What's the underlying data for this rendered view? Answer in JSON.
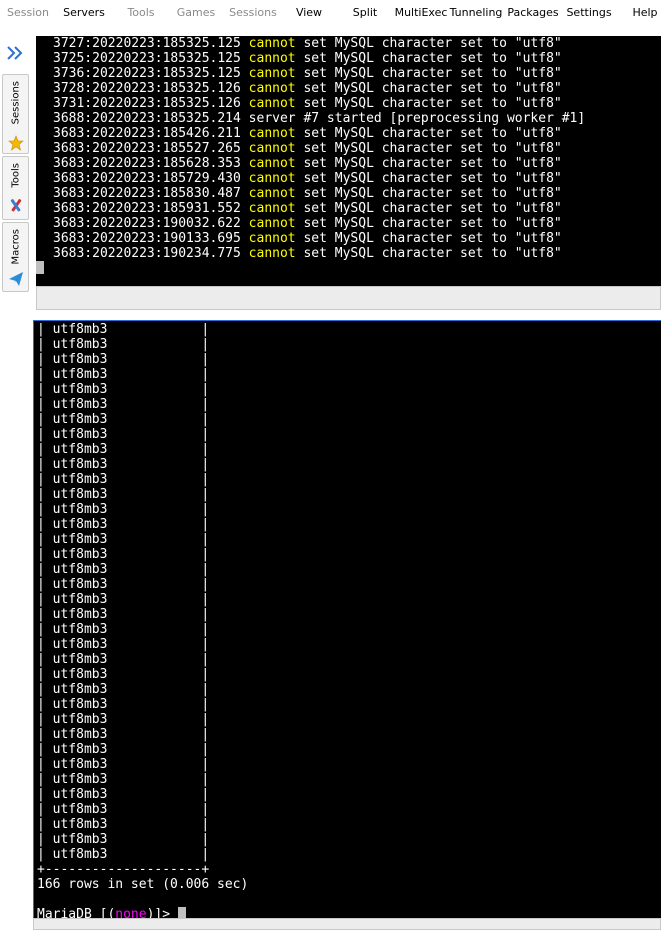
{
  "menu": {
    "items": [
      {
        "label": "Session",
        "disabled": true
      },
      {
        "label": "Servers",
        "disabled": false
      },
      {
        "label": "Tools",
        "disabled": true
      },
      {
        "label": "Games",
        "disabled": true
      },
      {
        "label": "Sessions",
        "disabled": true
      },
      {
        "label": "View",
        "disabled": false
      },
      {
        "label": "Split",
        "disabled": false
      },
      {
        "label": "MultiExec",
        "disabled": false
      },
      {
        "label": "Tunneling",
        "disabled": false
      },
      {
        "label": "Packages",
        "disabled": false
      },
      {
        "label": "Settings",
        "disabled": false
      },
      {
        "label": "Help",
        "disabled": false
      }
    ]
  },
  "sidebar": {
    "tabs": [
      {
        "label": "Sessions",
        "icon": "star-icon"
      },
      {
        "label": "Tools",
        "icon": "tools-icon"
      },
      {
        "label": "Macros",
        "icon": "paper-plane-icon"
      }
    ],
    "collapse_icon": "double-chevron-right-icon",
    "accent_color": "#2a6fd8"
  },
  "terminal_top": {
    "lines": [
      {
        "prefix": "3727:20220223:185325.125 ",
        "keyword": "cannot",
        "rest": " set MySQL character set to \"utf8\""
      },
      {
        "prefix": "3725:20220223:185325.125 ",
        "keyword": "cannot",
        "rest": " set MySQL character set to \"utf8\""
      },
      {
        "prefix": "3736:20220223:185325.125 ",
        "keyword": "cannot",
        "rest": " set MySQL character set to \"utf8\""
      },
      {
        "prefix": "3728:20220223:185325.126 ",
        "keyword": "cannot",
        "rest": " set MySQL character set to \"utf8\""
      },
      {
        "prefix": "3731:20220223:185325.126 ",
        "keyword": "cannot",
        "rest": " set MySQL character set to \"utf8\""
      },
      {
        "prefix": "3688:20220223:185325.214 server #7 started [preprocessing worker #1]",
        "keyword": "",
        "rest": ""
      },
      {
        "prefix": "3683:20220223:185426.211 ",
        "keyword": "cannot",
        "rest": " set MySQL character set to \"utf8\""
      },
      {
        "prefix": "3683:20220223:185527.265 ",
        "keyword": "cannot",
        "rest": " set MySQL character set to \"utf8\""
      },
      {
        "prefix": "3683:20220223:185628.353 ",
        "keyword": "cannot",
        "rest": " set MySQL character set to \"utf8\""
      },
      {
        "prefix": "3683:20220223:185729.430 ",
        "keyword": "cannot",
        "rest": " set MySQL character set to \"utf8\""
      },
      {
        "prefix": "3683:20220223:185830.487 ",
        "keyword": "cannot",
        "rest": " set MySQL character set to \"utf8\""
      },
      {
        "prefix": "3683:20220223:185931.552 ",
        "keyword": "cannot",
        "rest": " set MySQL character set to \"utf8\""
      },
      {
        "prefix": "3683:20220223:190032.622 ",
        "keyword": "cannot",
        "rest": " set MySQL character set to \"utf8\""
      },
      {
        "prefix": "3683:20220223:190133.695 ",
        "keyword": "cannot",
        "rest": " set MySQL character set to \"utf8\""
      },
      {
        "prefix": "3683:20220223:190234.775 ",
        "keyword": "cannot",
        "rest": " set MySQL character set to \"utf8\""
      }
    ]
  },
  "terminal_bottom": {
    "rows": [
      "| utf8mb3            |",
      "| utf8mb3            |",
      "| utf8mb3            |",
      "| utf8mb3            |",
      "| utf8mb3            |",
      "| utf8mb3            |",
      "| utf8mb3            |",
      "| utf8mb3            |",
      "| utf8mb3            |",
      "| utf8mb3            |",
      "| utf8mb3            |",
      "| utf8mb3            |",
      "| utf8mb3            |",
      "| utf8mb3            |",
      "| utf8mb3            |",
      "| utf8mb3            |",
      "| utf8mb3            |",
      "| utf8mb3            |",
      "| utf8mb3            |",
      "| utf8mb3            |",
      "| utf8mb3            |",
      "| utf8mb3            |",
      "| utf8mb3            |",
      "| utf8mb3            |",
      "| utf8mb3            |",
      "| utf8mb3            |",
      "| utf8mb3            |",
      "| utf8mb3            |",
      "| utf8mb3            |",
      "| utf8mb3            |",
      "| utf8mb3            |",
      "| utf8mb3            |",
      "| utf8mb3            |",
      "| utf8mb3            |",
      "| utf8mb3            |",
      "| utf8mb3            |"
    ],
    "table_border": "+--------------------+",
    "summary": "166 rows in set (0.006 sec)",
    "prompt_prefix": "MariaDB [(",
    "prompt_db": "none",
    "prompt_suffix": ")]> "
  },
  "colors": {
    "terminal_bg": "#000000",
    "keyword": "#ffff00",
    "prompt_db": "#ff00ff"
  }
}
